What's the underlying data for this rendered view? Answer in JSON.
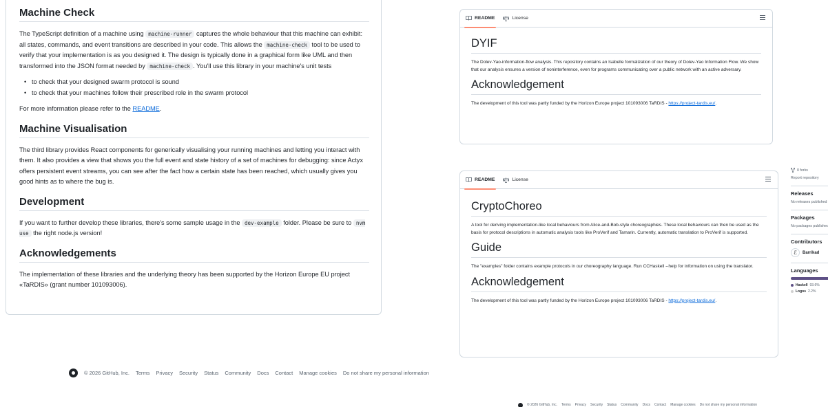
{
  "left": {
    "h_machine_check": "Machine Check",
    "p1": [
      "The TypeScript definition of a machine using ",
      "machine-runner",
      " captures the whole behaviour that this machine can exhibit: all states, commands, and event transitions are described in your code. This allows the ",
      "machine-check",
      " tool to be used to verify that your implementation is as you designed it. The design is typically done in a graphical form like UML and then transformed into the JSON format needed by ",
      "machine-check",
      ". You'll use this library in your machine's unit tests"
    ],
    "bullets": [
      "to check that your designed swarm protocol is sound",
      "to check that your machines follow their prescribed role in the swarm protocol"
    ],
    "more_info": [
      "For more information please refer to the ",
      "README",
      "."
    ],
    "h_visualisation": "Machine Visualisation",
    "p_visualisation": "The third library provides React components for generically visualising your running machines and letting you interact with them. It also provides a view that shows you the full event and state history of a set of machines for debugging: since Actyx offers persistent event streams, you can see after the fact how a certain state has been reached, which usually gives you good hints as to where the bug is.",
    "h_development": "Development",
    "p_development": [
      "If you want to further develop these libraries, there's some sample usage in the ",
      "dev-example",
      " folder. Please be sure to ",
      "nvm use",
      " the right node.js version!"
    ],
    "h_ack": "Acknowledgements",
    "p_ack": "The implementation of these libraries and the underlying theory has been supported by the Horizon Europe EU project «TaRDIS» (grant number 101093006)."
  },
  "footer": {
    "copyright": "© 2026 GitHub, Inc.",
    "links": [
      "Terms",
      "Privacy",
      "Security",
      "Status",
      "Community",
      "Docs",
      "Contact",
      "Manage cookies",
      "Do not share my personal information"
    ]
  },
  "dyif": {
    "tab_readme": "README",
    "tab_license": "License",
    "title": "DYIF",
    "desc": "The Dolev-Yao-information-flow analysis. This repository contains an Isabelle formalization of our theory of Dolev-Yao Information Flow. We show that our analysis ensures a version of noninterference, even for programs communicating over a public network with an active adversary.",
    "h_ack": "Acknowledgement",
    "ack_text": "The development of this tool was partly funded by the Horizon Europe project 101093006 TaRDIS - ",
    "ack_link": "https://project-tardis.eu/",
    "ack_end": "."
  },
  "crypto": {
    "tab_readme": "README",
    "tab_license": "License",
    "title": "CryptoChoreo",
    "desc": "A tool for deriving implementation-like local behaviours from Alice-and-Bob-style choreographies. These local behaviours can then be used as the basis for protocol descriptions in automatic analysis tools like ProVerif and Tamarin. Currently, automatic translation to ProVerif is supported.",
    "h_guide": "Guide",
    "guide_text": "The \"examples\" folder contains example protocols in our choreography language. Run CCHaskell --help for information on using the translator.",
    "h_ack": "Acknowledgement",
    "ack_text": "The development of this tool was partly funded by the Horizon Europe project 101093006 TaRDIS - ",
    "ack_link": "https://project-tardis.eu/",
    "ack_end": "."
  },
  "sidebar": {
    "forks": "0 forks",
    "report": "Report repository",
    "releases_h": "Releases",
    "releases_t": "No releases published",
    "packages_h": "Packages",
    "packages_t": "No packages published",
    "contributors_h": "Contributors",
    "contributor": "Barrikad",
    "languages_h": "Languages",
    "lang1": "Haskell",
    "lang1_pct": "93.6%",
    "lang2": "Logos",
    "lang2_pct": "2.2%",
    "lang1_color": "#5e5086",
    "lang2_color": "#d0d0d0"
  },
  "footer_right": {
    "copyright": "© 2026 GitHub, Inc.",
    "links": [
      "Terms",
      "Privacy",
      "Security",
      "Status",
      "Community",
      "Docs",
      "Contact",
      "Manage cookies",
      "Do not share my personal information"
    ]
  }
}
